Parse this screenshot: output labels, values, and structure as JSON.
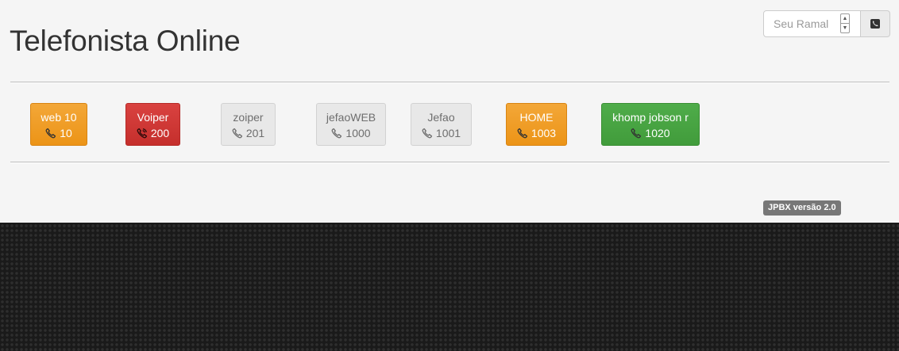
{
  "header": {
    "title": "Telefonista Online"
  },
  "ramal": {
    "placeholder": "Seu Ramal",
    "value": "",
    "call_button_icon": "phone-square-icon"
  },
  "extensions": [
    {
      "name": "web 10",
      "number": "10",
      "status": "warning",
      "icon": "phone-icon"
    },
    {
      "name": "Voiper",
      "number": "200",
      "status": "danger",
      "icon": "phone-volume-icon"
    },
    {
      "name": "zoiper",
      "number": "201",
      "status": "default",
      "icon": "phone-icon"
    },
    {
      "name": "jefaoWEB",
      "number": "1000",
      "status": "default",
      "icon": "phone-icon"
    },
    {
      "name": "Jefao",
      "number": "1001",
      "status": "default",
      "icon": "phone-icon"
    },
    {
      "name": "HOME",
      "number": "1003",
      "status": "warning",
      "icon": "phone-icon"
    },
    {
      "name": "khomp jobson r",
      "number": "1020",
      "status": "success",
      "icon": "phone-icon"
    }
  ],
  "footer": {
    "version": "JPBX versão 2.0"
  },
  "colors": {
    "warning": "#ef9c21",
    "danger": "#cd3633",
    "default": "#e8e8e8",
    "success": "#47a442",
    "panel_background": "#f5f5f5",
    "page_background": "#1a1a1a"
  }
}
